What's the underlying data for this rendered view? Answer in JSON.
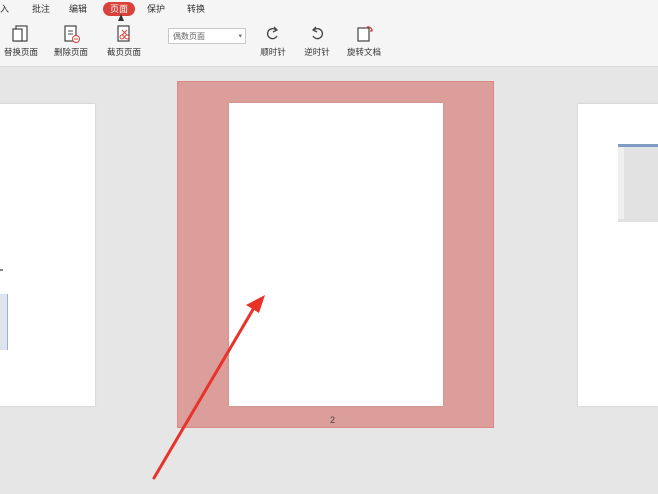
{
  "tabs": [
    {
      "label": "入"
    },
    {
      "label": "批注"
    },
    {
      "label": "编辑"
    },
    {
      "label": "页面",
      "active": true
    },
    {
      "label": "保护"
    },
    {
      "label": "转换"
    }
  ],
  "tools": {
    "replace_page": "替换页面",
    "delete_page": "删除页面",
    "crop_page": "截页页面",
    "clockwise": "顺时针",
    "counterclockwise": "逆时针",
    "rotate_document": "旋转文档"
  },
  "page_select": {
    "value": "偶数页面"
  },
  "current_page_number": "2",
  "colors": {
    "accent": "#d9423a",
    "selection_fill": "#dc9e9b",
    "arrow": "#e8332b"
  }
}
